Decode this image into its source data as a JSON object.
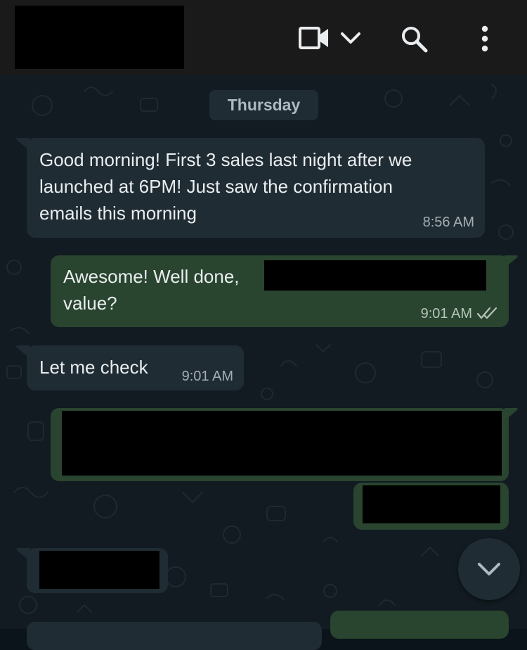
{
  "header": {
    "video_call_icon": "video-camera-icon",
    "dropdown_icon": "chevron-down-icon",
    "search_icon": "search-icon",
    "menu_icon": "kebab-menu-icon"
  },
  "date_divider": "Thursday",
  "messages": [
    {
      "direction": "incoming",
      "lines": [
        "Good morning! First 3 sales last night after we",
        "launched at 6PM! Just saw the confirmation",
        "emails this morning"
      ],
      "time": "8:56 AM"
    },
    {
      "direction": "outgoing",
      "lines": [
        "Awesome! Well done,",
        "value?"
      ],
      "time": "9:01 AM",
      "status": "double-check-icon"
    },
    {
      "direction": "incoming",
      "lines": [
        "Let me check"
      ],
      "time": "9:01 AM"
    }
  ],
  "colors": {
    "background": "#0b141a",
    "header": "#1a1a1a",
    "incoming_bubble": "#202c33",
    "outgoing_bubble": "#29442f",
    "text": "#e9edef",
    "timestamp": "#a4aeb3"
  },
  "scroll_button_icon": "chevron-down-icon"
}
